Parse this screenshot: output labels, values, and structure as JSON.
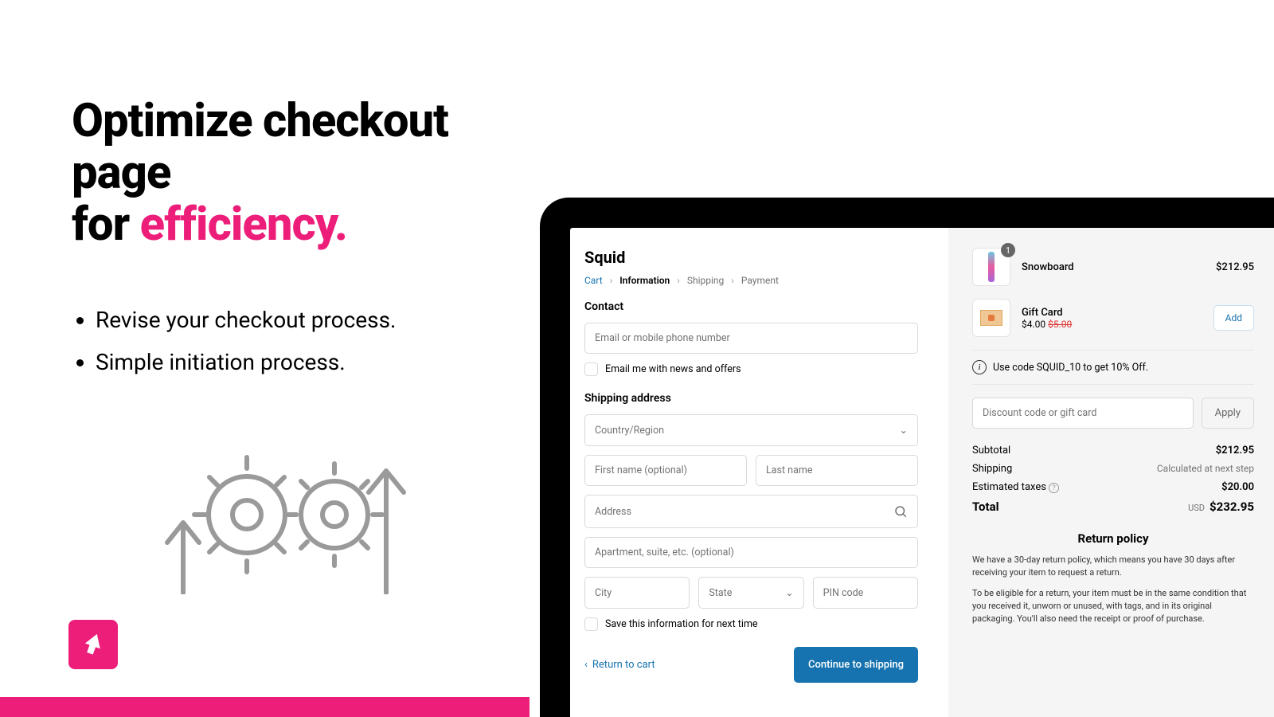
{
  "hero": {
    "line1": "Optimize checkout page",
    "line2_prefix": "for ",
    "line2_accent": "efficiency."
  },
  "bullets": [
    "Revise your checkout process.",
    "Simple initiation process."
  ],
  "checkout": {
    "brand": "Squid",
    "breadcrumb": {
      "cart": "Cart",
      "info": "Information",
      "shipping": "Shipping",
      "payment": "Payment"
    },
    "contact": {
      "title": "Contact",
      "email_placeholder": "Email or mobile phone number",
      "newsletter": "Email me with news and offers"
    },
    "shipping": {
      "title": "Shipping address",
      "country": "Country/Region",
      "first": "First name (optional)",
      "last": "Last name",
      "address": "Address",
      "apt": "Apartment, suite, etc. (optional)",
      "city": "City",
      "state": "State",
      "pin": "PIN code",
      "save": "Save this information for next time"
    },
    "actions": {
      "back": "Return to cart",
      "continue": "Continue to shipping"
    }
  },
  "summary": {
    "items": [
      {
        "name": "Snowboard",
        "qty": 1,
        "price": "$212.95"
      },
      {
        "name": "Gift Card",
        "price": "$4.00",
        "compare": "$5.00",
        "add": "Add"
      }
    ],
    "promo": "Use code SQUID_10 to get 10% Off.",
    "discount_placeholder": "Discount code or gift card",
    "apply": "Apply",
    "rows": {
      "subtotal_l": "Subtotal",
      "subtotal_v": "$212.95",
      "ship_l": "Shipping",
      "ship_v": "Calculated at next step",
      "tax_l": "Estimated taxes",
      "tax_v": "$20.00",
      "total_l": "Total",
      "total_cur": "USD",
      "total_v": "$232.95"
    },
    "policy": {
      "title": "Return policy",
      "p1": "We have a 30-day return policy, which means you have 30 days after receiving your item to request a return.",
      "p2": "To be eligible for a return, your item must be in the same condition that you received it, unworn or unused, with tags, and in its original packaging. You'll also need the receipt or proof of purchase."
    }
  }
}
